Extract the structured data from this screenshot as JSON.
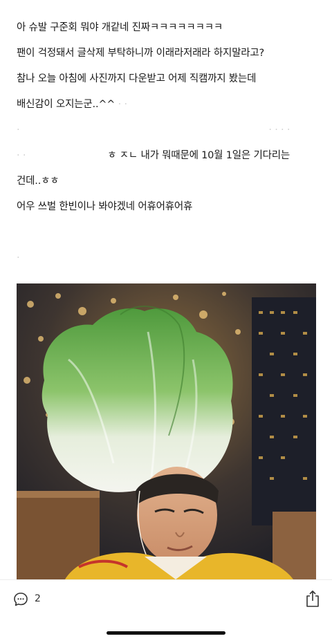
{
  "post": {
    "lines": [
      "아 슈발 구준회 뭐야 개같네 진짜ㅋㅋㅋㅋㅋㅋㅋㅋ",
      "팬이 걱정돼서 글삭제 부탁하니까 이래라저래라 하지말라고?",
      "참나 오늘 아침에 사진까지 다운받고 어제 직캠까지 봤는데",
      "배신감이 오지는군..^^",
      "",
      "ㅎ ㅈㄴ 내가 뭐때문에 10월 1일은 기다리는",
      "건데..ㅎㅎ",
      "어우 쓰벌 한빈이나 봐야겠네 어휴어휴어휴",
      ""
    ]
  },
  "toolbar": {
    "comment_count": "2",
    "comment_icon": "speech-bubble-icon",
    "share_icon": "share-icon"
  }
}
